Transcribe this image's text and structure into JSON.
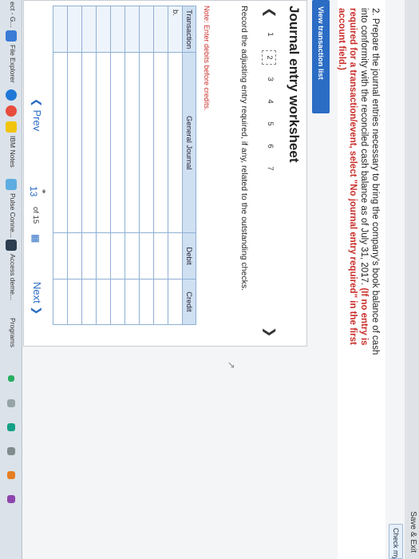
{
  "header": {
    "save_exit": "Save & Exit",
    "check_label": "Check my wo"
  },
  "question": {
    "text": "2. Prepare the journal entries necessary to bring the company's book balance of cash into conformity with the reconciled cash balance as of July 31, 2017.",
    "red_text": "(If no entry is required for a transaction/event, select \"No journal entry required\" in the first account field.)"
  },
  "view_transaction_list": "View transaction list",
  "worksheet": {
    "title": "Journal entry worksheet",
    "pages": [
      "1",
      "2",
      "3",
      "4",
      "5",
      "6",
      "7"
    ],
    "active_page": "2",
    "instruction": "Record the adjusting entry required, if any, related to the outstanding checks.",
    "note": "Note: Enter debits before credits.",
    "columns": [
      "Transaction",
      "General Journal",
      "Debit",
      "Credit"
    ],
    "rows": [
      {
        "tx": "b.",
        "acct": "",
        "debit": "",
        "credit": ""
      },
      {
        "tx": "",
        "acct": "",
        "debit": "",
        "credit": ""
      },
      {
        "tx": "",
        "acct": "",
        "debit": "",
        "credit": ""
      },
      {
        "tx": "",
        "acct": "",
        "debit": "",
        "credit": ""
      },
      {
        "tx": "",
        "acct": "",
        "debit": "",
        "credit": ""
      },
      {
        "tx": "",
        "acct": "",
        "debit": "",
        "credit": ""
      },
      {
        "tx": "",
        "acct": "",
        "debit": "",
        "credit": ""
      },
      {
        "tx": "",
        "acct": "",
        "debit": "",
        "credit": ""
      },
      {
        "tx": "",
        "acct": "",
        "debit": "",
        "credit": ""
      }
    ]
  },
  "navigation": {
    "prev": "Prev",
    "current": "13",
    "of": "of 15",
    "next": "Next"
  },
  "taskbar": {
    "items": [
      "ect - G...",
      "File Explorer",
      "IBM Notes",
      "Pulse Conne...",
      "Access deme...",
      "Programs"
    ]
  }
}
